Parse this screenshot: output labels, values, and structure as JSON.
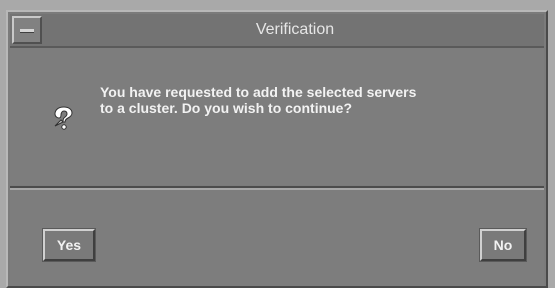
{
  "dialog": {
    "title": "Verification",
    "message": "You have requested to add the selected servers\nto a cluster.  Do you wish to continue?",
    "icon": "question-icon",
    "buttons": {
      "yes_label": "Yes",
      "no_label": "No"
    }
  }
}
